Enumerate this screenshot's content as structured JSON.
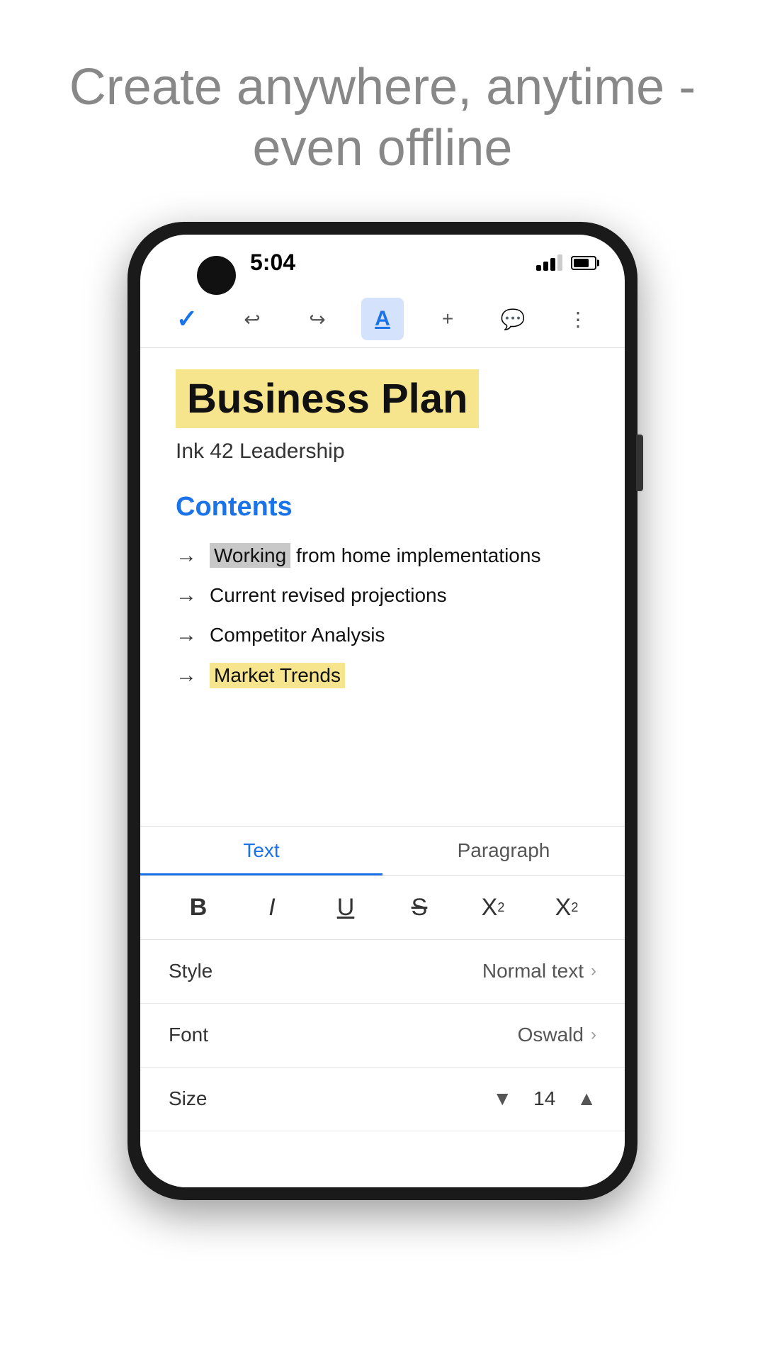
{
  "hero": {
    "text": "Create anywhere, anytime - even offline"
  },
  "phone": {
    "status": {
      "time": "5:04"
    },
    "toolbar": {
      "check_label": "✓",
      "undo_label": "↩",
      "redo_label": "↪",
      "text_format_label": "A",
      "add_label": "+",
      "comment_label": "☰",
      "more_label": "⋮"
    },
    "document": {
      "title": "Business Plan",
      "subtitle": "Ink 42 Leadership",
      "heading": "Contents",
      "list_items": [
        {
          "text_before_highlight": "",
          "highlight": "Working",
          "text_after": " from home implementations"
        },
        {
          "text": "Current revised projections"
        },
        {
          "text": "Competitor Analysis"
        },
        {
          "text_highlight_yellow": "Market Trends"
        }
      ]
    },
    "panel": {
      "tab_text": "Text",
      "tab_paragraph": "Paragraph",
      "format_buttons": [
        {
          "label": "B",
          "type": "bold"
        },
        {
          "label": "I",
          "type": "italic"
        },
        {
          "label": "U",
          "type": "underline"
        },
        {
          "label": "S",
          "type": "strikethrough"
        },
        {
          "label": "X²",
          "type": "superscript"
        },
        {
          "label": "X₂",
          "type": "subscript"
        }
      ],
      "style_label": "Style",
      "style_value": "Normal text",
      "font_label": "Font",
      "font_value": "Oswald",
      "size_label": "Size",
      "size_value": "14"
    }
  }
}
